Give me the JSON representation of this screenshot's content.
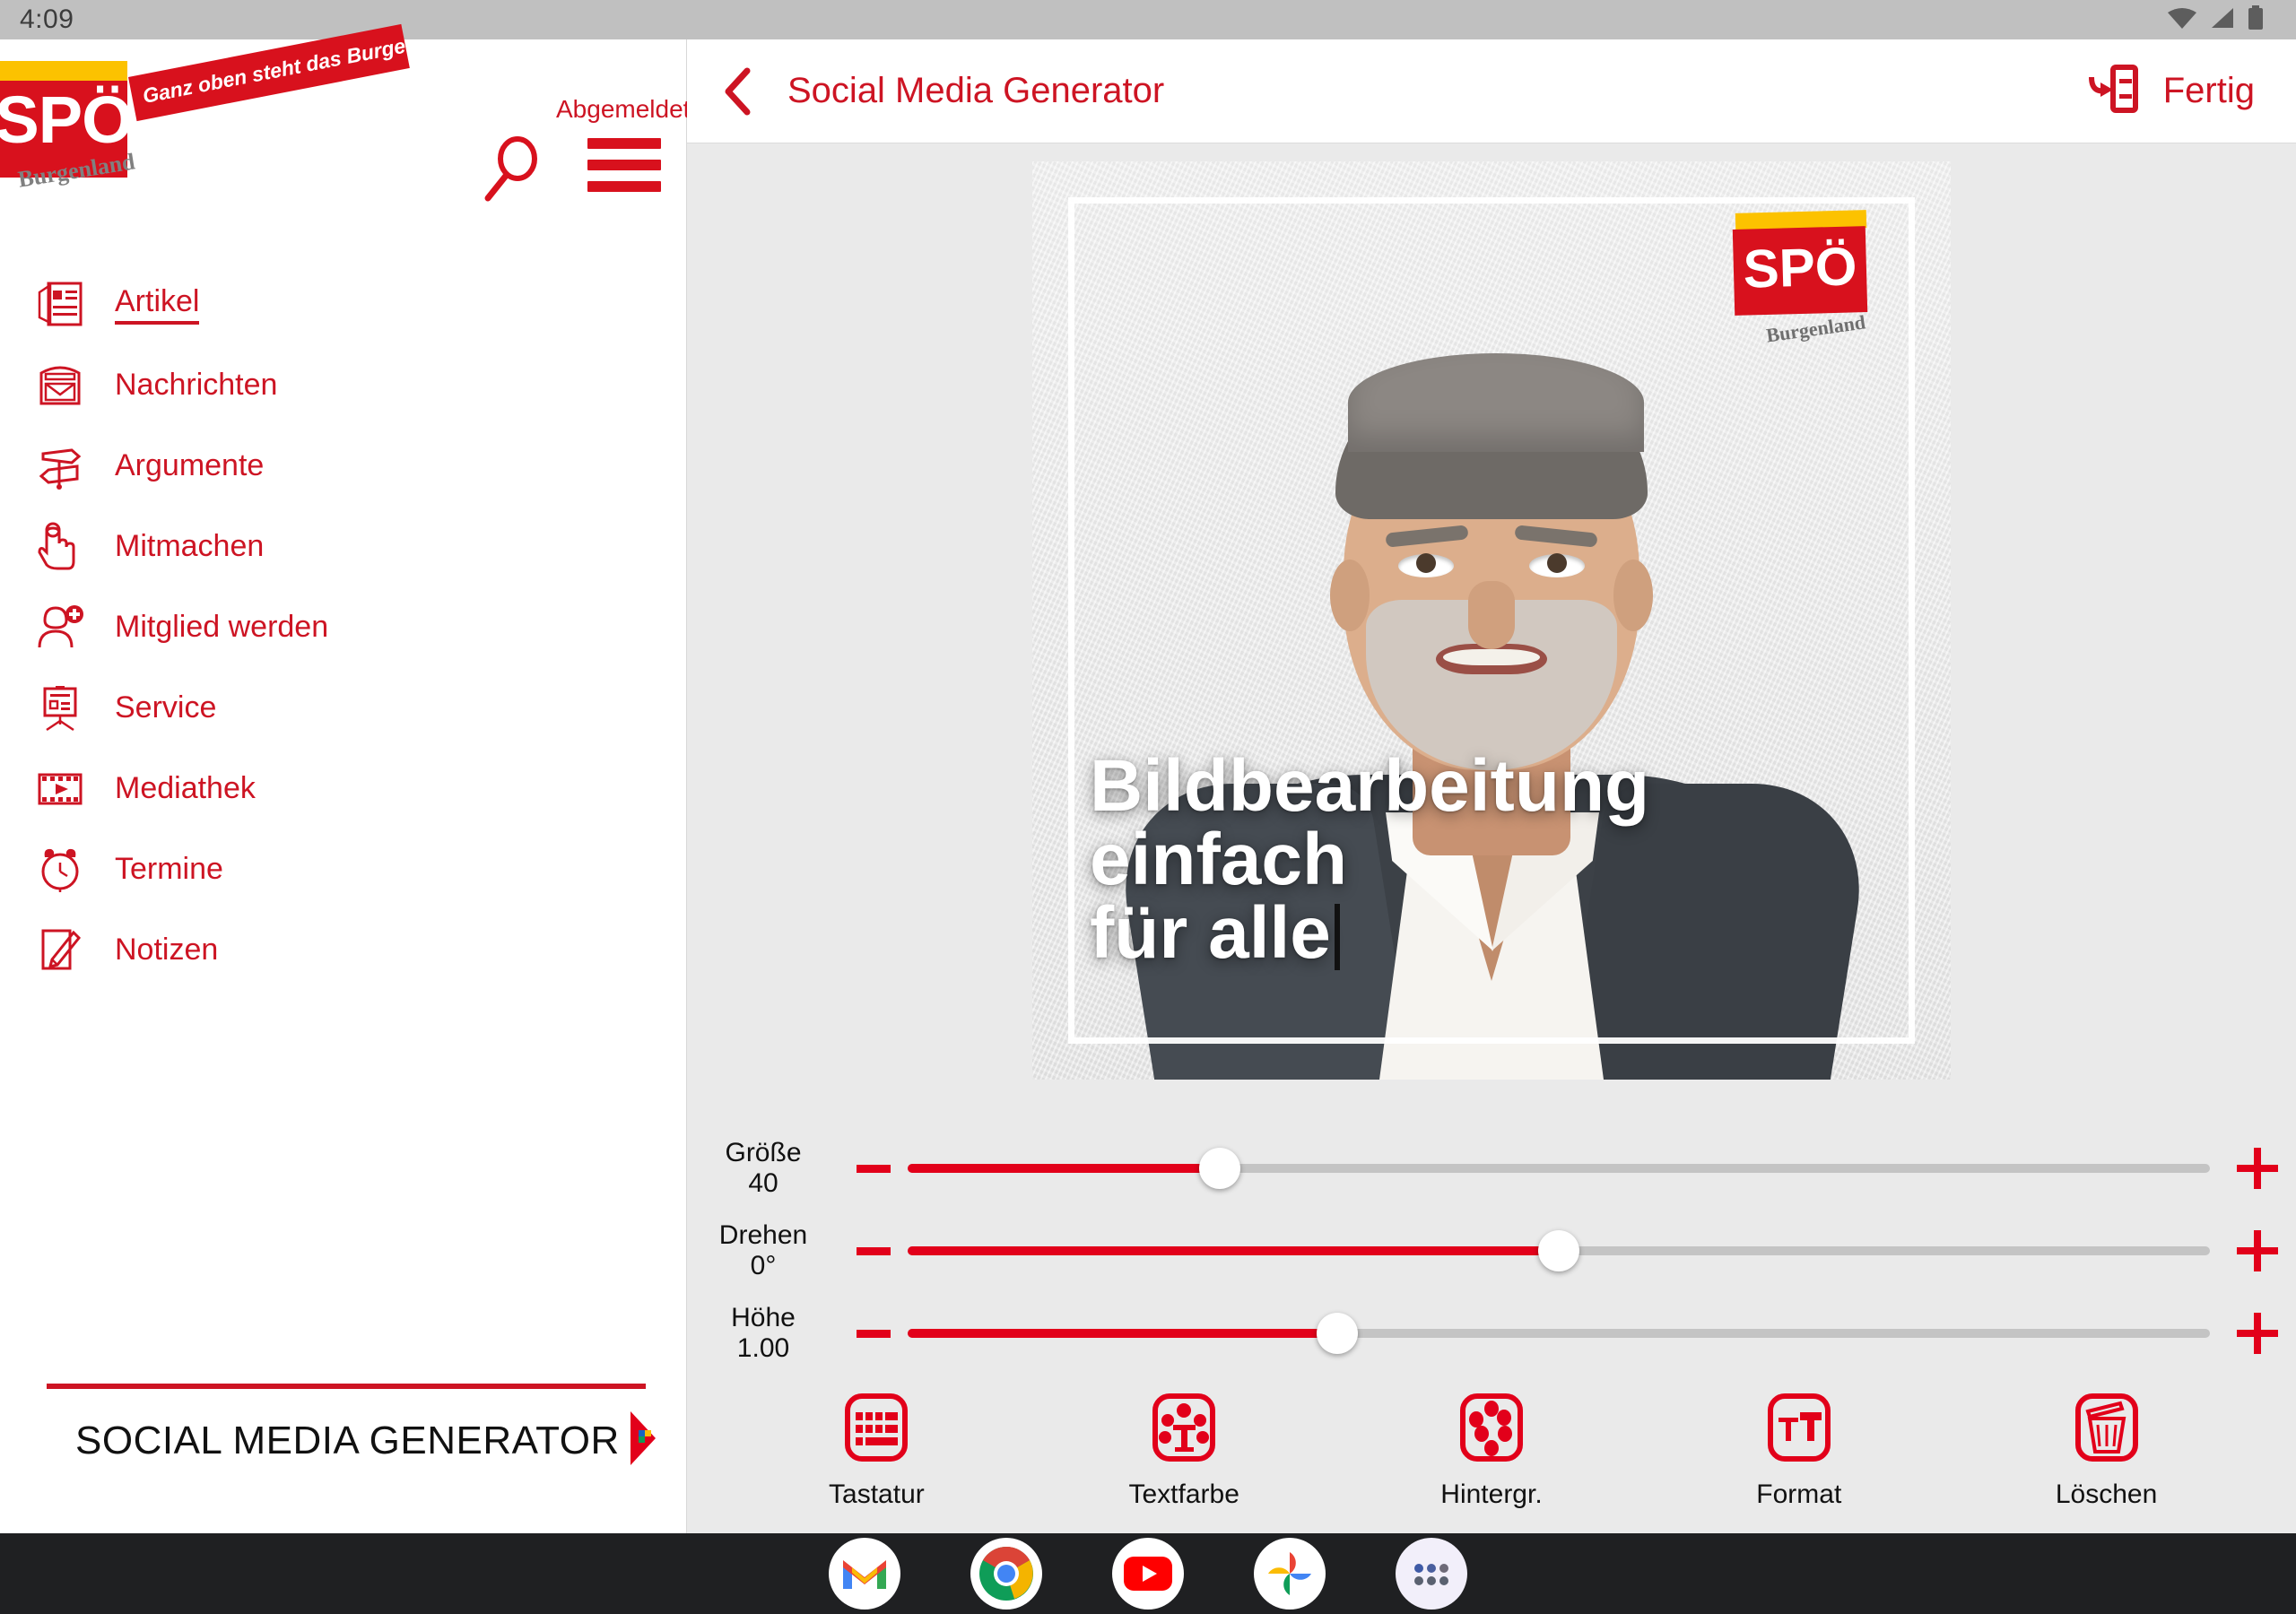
{
  "status_bar": {
    "clock": "4:09",
    "icons": [
      "wifi-icon",
      "cell-signal-icon",
      "battery-icon"
    ]
  },
  "brand": {
    "logo_text": "SPÖ",
    "logo_sub": "Burgenland",
    "slogan": "Ganz oben steht das Burgenland.",
    "accent_red": "#cd1423",
    "logo_red": "#d8111d",
    "logo_gold": "#fcc200"
  },
  "left_panel": {
    "account_status": "Abgemeldet",
    "search_icon": "search-icon",
    "menu_icon": "hamburger-menu-icon",
    "nav_items": [
      {
        "label": "Artikel",
        "icon": "article-icon",
        "active": true
      },
      {
        "label": "Nachrichten",
        "icon": "mailbox-icon",
        "active": false
      },
      {
        "label": "Argumente",
        "icon": "signpost-icon",
        "active": false
      },
      {
        "label": "Mitmachen",
        "icon": "pointing-hand-icon",
        "active": false
      },
      {
        "label": "Mitglied werden",
        "icon": "add-user-icon",
        "active": false
      },
      {
        "label": "Service",
        "icon": "flipchart-icon",
        "active": false
      },
      {
        "label": "Mediathek",
        "icon": "filmstrip-icon",
        "active": false
      },
      {
        "label": "Termine",
        "icon": "alarm-clock-icon",
        "active": false
      },
      {
        "label": "Notizen",
        "icon": "notepad-pencil-icon",
        "active": false
      }
    ],
    "drawer_item": {
      "label": "SOCIAL MEDIA GENERATOR",
      "arrow_icon": "chevron-right-icon"
    }
  },
  "editor": {
    "back_icon": "back-chevron-icon",
    "title": "Social Media Generator",
    "export_icon": "export-to-document-icon",
    "done_label": "Fertig",
    "canvas": {
      "badge_text": "SPÖ",
      "badge_sub": "Burgenland",
      "overlay_text": "Bildbearbeitung einfach\nfür alle",
      "overlay_color": "#ffffff",
      "caret_visible": true
    },
    "sliders": [
      {
        "name": "Größe",
        "value": "40",
        "fill_percent": 24,
        "minus_icon": "minus-icon",
        "plus_icon": "plus-icon"
      },
      {
        "name": "Drehen",
        "value": "0°",
        "fill_percent": 50,
        "minus_icon": "minus-icon",
        "plus_icon": "plus-icon"
      },
      {
        "name": "Höhe",
        "value": "1.00",
        "fill_percent": 33,
        "minus_icon": "minus-icon",
        "plus_icon": "plus-icon"
      }
    ],
    "tools": [
      {
        "label": "Tastatur",
        "icon": "keyboard-icon"
      },
      {
        "label": "Textfarbe",
        "icon": "text-color-icon"
      },
      {
        "label": "Hintergr.",
        "icon": "background-color-icon"
      },
      {
        "label": "Format",
        "icon": "text-format-icon"
      },
      {
        "label": "Löschen",
        "icon": "trash-icon"
      }
    ]
  },
  "android_nav": {
    "apps": [
      {
        "name": "gmail-icon"
      },
      {
        "name": "chrome-icon"
      },
      {
        "name": "youtube-icon"
      },
      {
        "name": "google-photos-icon"
      },
      {
        "name": "app-drawer-icon"
      }
    ]
  }
}
